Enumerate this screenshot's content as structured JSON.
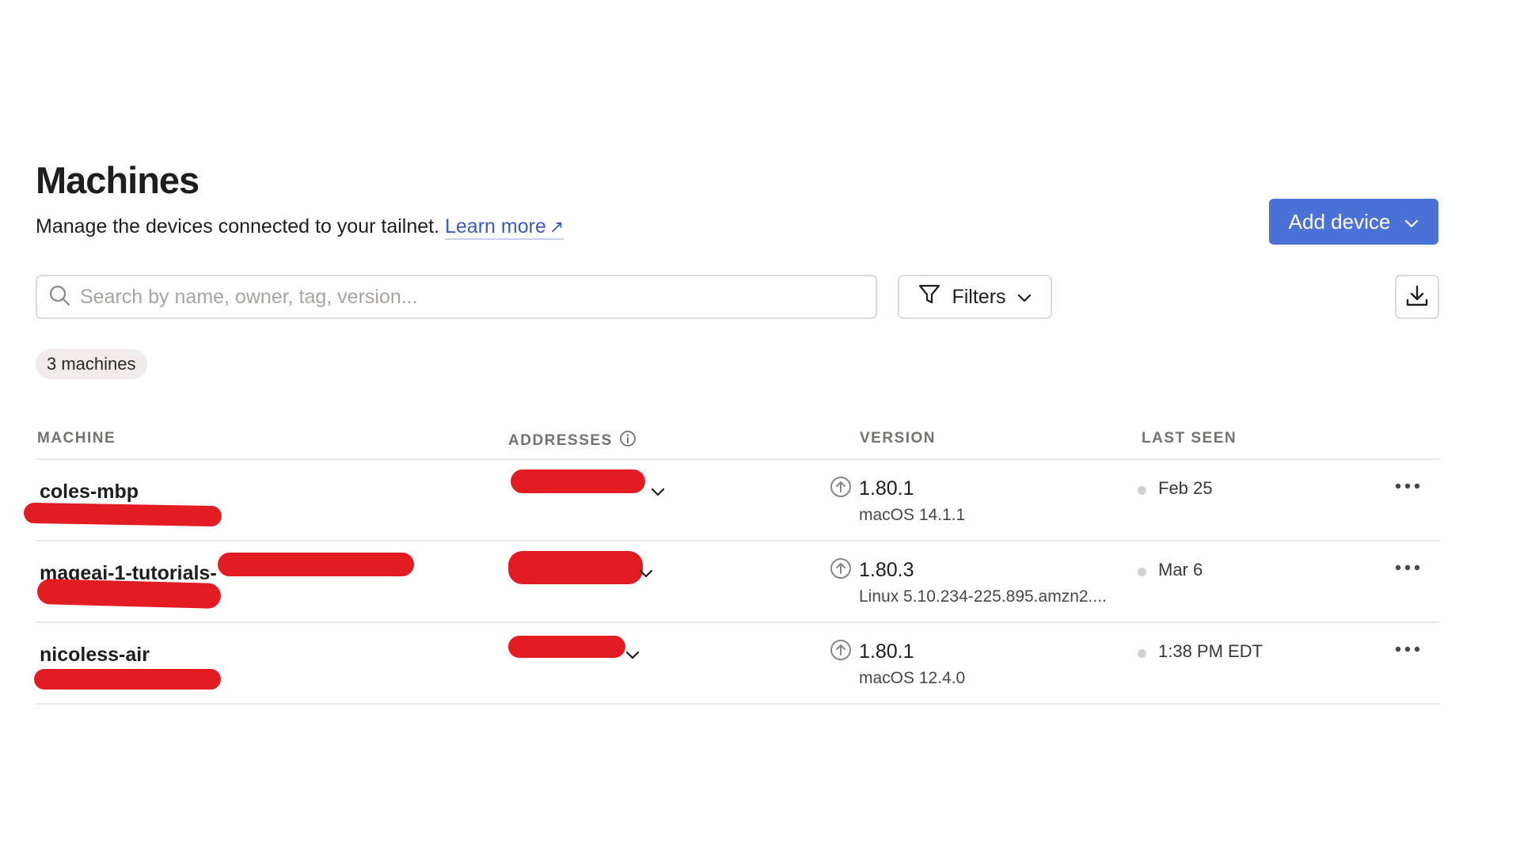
{
  "header": {
    "title": "Machines",
    "subtitle": "Manage the devices connected to your tailnet.",
    "learn_more": "Learn more",
    "add_device_label": "Add device"
  },
  "toolbar": {
    "search_placeholder": "Search by name, owner, tag, version...",
    "filters_label": "Filters",
    "export_icon": "download-icon"
  },
  "summary": {
    "count_label": "3 machines"
  },
  "table": {
    "columns": {
      "machine": "MACHINE",
      "addresses": "ADDRESSES",
      "version": "VERSION",
      "last_seen": "LAST SEEN"
    },
    "rows": [
      {
        "name": "coles-mbp",
        "version": "1.80.1",
        "os": "macOS 14.1.1",
        "last_seen": "Feb 25"
      },
      {
        "name": "mageai-1-tutorials-",
        "version": "1.80.3",
        "os": "Linux 5.10.234-225.895.amzn2....",
        "last_seen": "Mar 6"
      },
      {
        "name": "nicoless-air",
        "version": "1.80.1",
        "os": "macOS 12.4.0",
        "last_seen": "1:38 PM EDT"
      }
    ]
  },
  "colors": {
    "accent": "#4b71d6",
    "link": "#3a5bbf",
    "redaction": "#e31b23",
    "muted_header": "#75716e",
    "border": "#dedad7"
  }
}
